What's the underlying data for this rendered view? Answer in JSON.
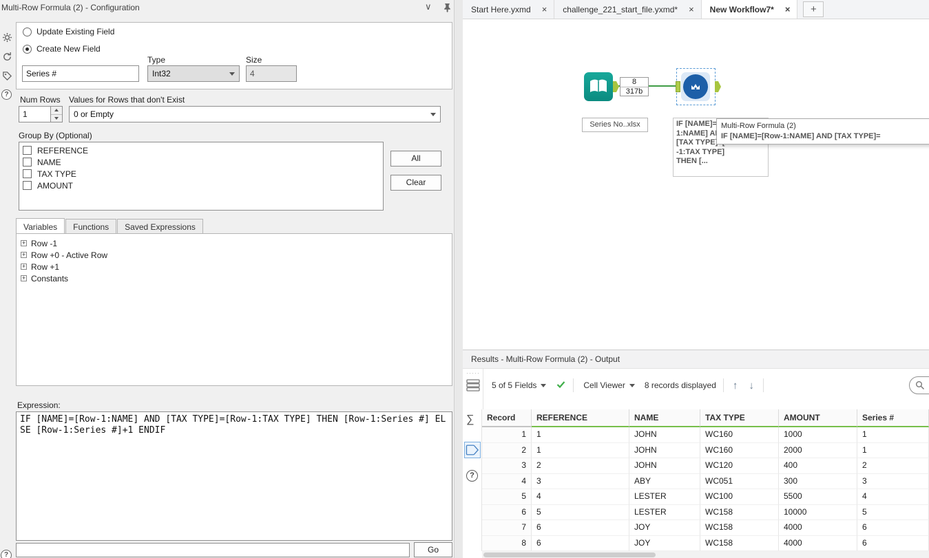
{
  "icons": {
    "close": "×",
    "plus": "+",
    "sum": "∑",
    "arrow_up": "↑",
    "arrow_down": "↓",
    "chevron_down": "∨",
    "grip_dots": "·····",
    "help": "?"
  },
  "config": {
    "title": "Multi-Row Formula (2) - Configuration",
    "update_radio": "Update Existing Field",
    "create_radio": "Create New Field",
    "field_name": "Series #",
    "type_label": "Type",
    "type_value": "Int32",
    "size_label": "Size",
    "size_value": "4",
    "num_rows_label": "Num Rows",
    "num_rows_value": "1",
    "values_label": "Values for Rows that don't Exist",
    "values_value": "0 or Empty",
    "group_by_label": "Group By (Optional)",
    "group_items": [
      "REFERENCE",
      "NAME",
      "TAX TYPE",
      "AMOUNT"
    ],
    "all_button": "All",
    "clear_button": "Clear",
    "expression_tabs": [
      "Variables",
      "Functions",
      "Saved Expressions"
    ],
    "active_tab": "Variables",
    "tree_items": [
      "Row -1",
      "Row +0 - Active Row",
      "Row +1",
      "Constants"
    ],
    "expression_label": "Expression:",
    "expression": "IF [NAME]=[Row-1:NAME] AND [TAX TYPE]=[Row-1:TAX TYPE] THEN [Row-1:Series #] ELSE [Row-1:Series #]+1 ENDIF",
    "go_button": "Go"
  },
  "workflow": {
    "tabs": [
      {
        "label": "Start Here.yxmd",
        "active": false
      },
      {
        "label": "challenge_221_start_file.yxmd*",
        "active": false
      },
      {
        "label": "New Workflow7*",
        "active": true
      }
    ],
    "input_tool_label": "Series No..xlsx",
    "connection_records": "8",
    "connection_size": "317b",
    "annotation_lines": [
      "IF [NAME]=[Row-",
      "1:NAME] AND",
      "[TAX TYPE]=[Row",
      "-1:TAX TYPE]",
      "THEN [..."
    ],
    "tooltip_title": "Multi-Row Formula (2)",
    "tooltip_text": "IF [NAME]=[Row-1:NAME] AND [TAX TYPE]="
  },
  "results": {
    "title": "Results - Multi-Row Formula (2) - Output",
    "fields_dropdown": "5 of 5 Fields",
    "cell_viewer_dropdown": "Cell Viewer",
    "records_displayed": "8 records displayed",
    "table": {
      "columns": [
        "Record",
        "REFERENCE",
        "NAME",
        "TAX TYPE",
        "AMOUNT",
        "Series #"
      ],
      "rows": [
        [
          "1",
          "1",
          "JOHN",
          "WC160",
          "1000",
          "1"
        ],
        [
          "2",
          "1",
          "JOHN",
          "WC160",
          "2000",
          "1"
        ],
        [
          "3",
          "2",
          "JOHN",
          "WC120",
          "400",
          "2"
        ],
        [
          "4",
          "3",
          "ABY",
          "WC051",
          "300",
          "3"
        ],
        [
          "5",
          "4",
          "LESTER",
          "WC100",
          "5500",
          "4"
        ],
        [
          "6",
          "5",
          "LESTER",
          "WC158",
          "10000",
          "5"
        ],
        [
          "7",
          "6",
          "JOY",
          "WC158",
          "4000",
          "6"
        ],
        [
          "8",
          "6",
          "JOY",
          "WC158",
          "4000",
          "6"
        ]
      ]
    }
  }
}
